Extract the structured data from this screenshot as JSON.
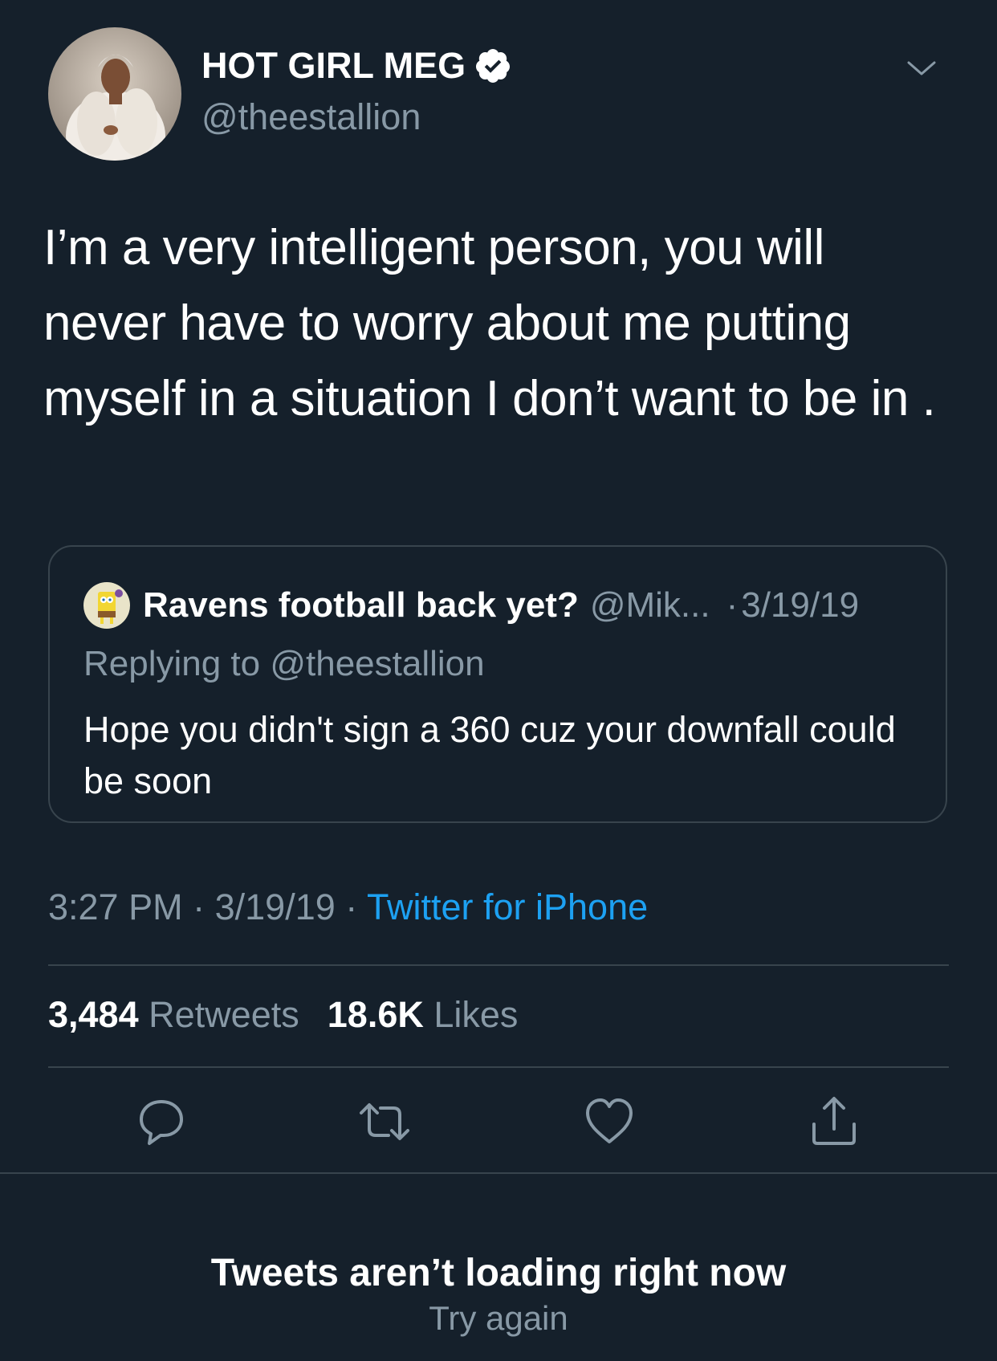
{
  "author": {
    "display_name": "HOT GIRL MEG",
    "handle": "@theestallion",
    "verified": true
  },
  "tweet": {
    "text": "I’m a very intelligent person, you will never have to worry about me putting myself in a situation I don’t want to be in ."
  },
  "quoted_tweet": {
    "name": "Ravens football back yet?",
    "handle": "@Mik...",
    "separator": "·",
    "date": "3/19/19",
    "replying_to": "Replying to @theestallion",
    "text": "Hope you didn't sign a 360 cuz your downfall could be soon"
  },
  "meta": {
    "time": "3:27 PM",
    "sep1": "·",
    "date": "3/19/19",
    "sep2": "·",
    "source": "Twitter for iPhone"
  },
  "stats": {
    "retweets_count": "3,484",
    "retweets_label": "Retweets",
    "likes_count": "18.6K",
    "likes_label": "Likes"
  },
  "actions": {
    "reply_icon": "reply-icon",
    "retweet_icon": "retweet-icon",
    "like_icon": "like-icon",
    "share_icon": "share-icon"
  },
  "empty_state": {
    "title": "Tweets aren’t loading right now",
    "retry": "Try again"
  },
  "colors": {
    "background": "#15202b",
    "text": "#ffffff",
    "secondary": "#8899a6",
    "accent": "#1da1f2",
    "border": "#38444d"
  }
}
